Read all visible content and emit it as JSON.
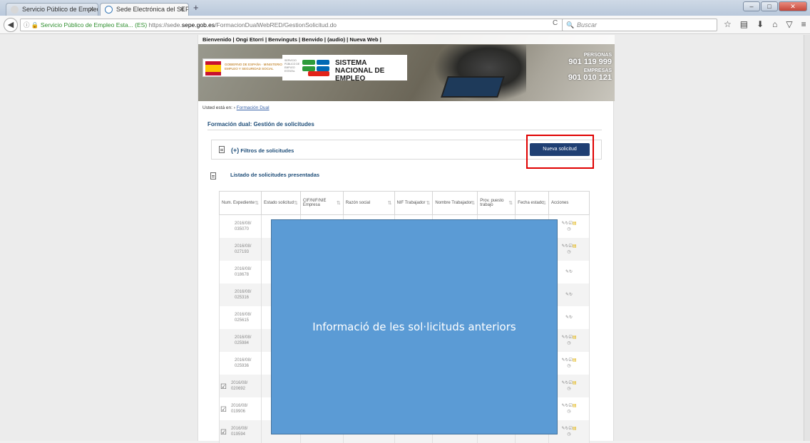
{
  "browser": {
    "tabs": [
      {
        "label": "Servicio Público de Empleo..."
      },
      {
        "label": "Sede Electrónica del SEPE..."
      }
    ],
    "url": {
      "org": "Servicio Público de Empleo Esta... (ES)",
      "prefix": "https://sede.",
      "host": "sepe.gob.es",
      "path": "/FormacionDualWebRED/GestionSolicitud.do"
    },
    "search_placeholder": "Buscar"
  },
  "site": {
    "top_links": "Bienvenido | Ongi Etorri | Benvinguts | Benvido | (audio) | Nueva Web |",
    "gov_text": "GOBIERNO DE ESPAÑA · MINISTERIO DE EMPLEO Y SEGURIDAD SOCIAL",
    "sepe_mini": "SERVICIO PÚBLICO DE EMPLEO ESTATAL",
    "brand_line1": "SISTEMA",
    "brand_line2": "NACIONAL DE EMPLEO",
    "contact": {
      "personas_label": "PERSONAS",
      "personas_phone": "901 119 999",
      "empresas_label": "EMPRESAS",
      "empresas_phone": "901 010 121"
    }
  },
  "breadcrumb": {
    "prefix": "Usted está en: ›",
    "link": "Formación Dual"
  },
  "page_title": "Formación dual: Gestión de solicitudes",
  "filters": {
    "toggle": "(+)",
    "label": "Filtros de solicitudes"
  },
  "new_request_button": "Nueva solicitud",
  "list_title": "Listado de solicitudes presentadas",
  "table": {
    "headers": [
      "Num. Expediente",
      "Estado solicitud",
      "CIF/NIF/NIE Empresa",
      "Razón social",
      "NIF Trabajador",
      "Nombre Trabajador",
      "Prov. puesto trabajo",
      "Fecha estado",
      "Acciones"
    ],
    "rows": [
      {
        "exp1": "2016/08/",
        "exp2": "035070",
        "edit": false,
        "actions": "full"
      },
      {
        "exp1": "2016/08/",
        "exp2": "027193",
        "edit": false,
        "actions": "full"
      },
      {
        "exp1": "2016/08/",
        "exp2": "018678",
        "edit": false,
        "actions": "short"
      },
      {
        "exp1": "2016/08/",
        "exp2": "025316",
        "edit": false,
        "actions": "short"
      },
      {
        "exp1": "2016/08/",
        "exp2": "025615",
        "edit": false,
        "actions": "short"
      },
      {
        "exp1": "2016/08/",
        "exp2": "025984",
        "edit": false,
        "actions": "full"
      },
      {
        "exp1": "2016/08/",
        "exp2": "025936",
        "edit": false,
        "actions": "full"
      },
      {
        "exp1": "2016/08/",
        "exp2": "020692",
        "edit": true,
        "actions": "full"
      },
      {
        "exp1": "2016/08/",
        "exp2": "019906",
        "edit": true,
        "actions": "full"
      },
      {
        "exp1": "2016/08/",
        "exp2": "019594",
        "edit": true,
        "actions": "full"
      }
    ]
  },
  "overlay_text": "Informació de les sol·licituds anteriors",
  "colors": {
    "overlay": "#5b9bd5",
    "highlight": "#e00000",
    "button": "#1f3f73",
    "title": "#1f4e79"
  }
}
